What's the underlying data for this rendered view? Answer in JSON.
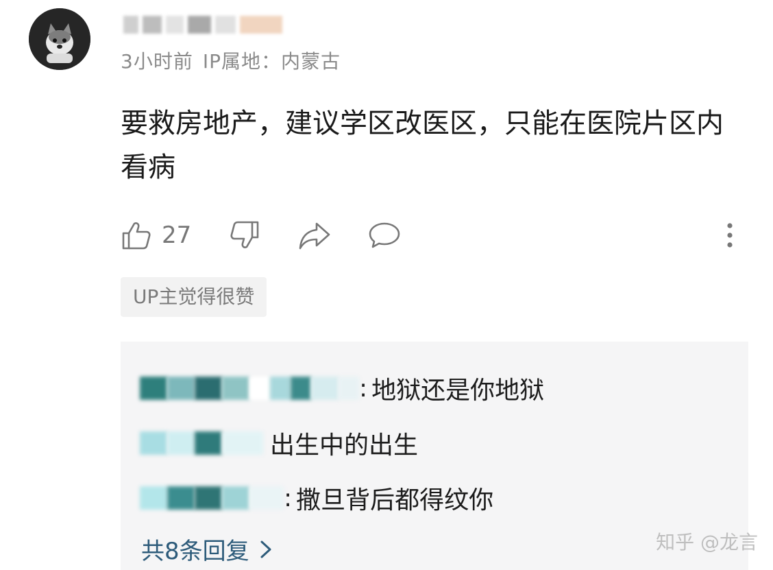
{
  "post": {
    "time": "3小时前",
    "ip_location": "IP属地：内蒙古",
    "comment_text": "要救房地产，建议学区改医区，只能在医院片区内看病",
    "like_count": "27",
    "badge": "UP主觉得很赞"
  },
  "replies": [
    {
      "separator": ":",
      "text": "地狱还是你地狱"
    },
    {
      "separator": "",
      "text": "出生中的出生"
    },
    {
      "separator": ":",
      "text": "撒旦背后都得纹你"
    }
  ],
  "more_replies_label": "共8条回复",
  "watermark": "知乎 @龙言",
  "icons": [
    "like-icon",
    "dislike-icon",
    "share-icon",
    "reply-icon",
    "more-icon",
    "chevron-right-icon"
  ],
  "colors": {
    "link": "#2d5b7a",
    "meta": "#8a8a8a",
    "badge_bg": "#f2f2f2",
    "reply_bg": "#f5f5f6"
  }
}
